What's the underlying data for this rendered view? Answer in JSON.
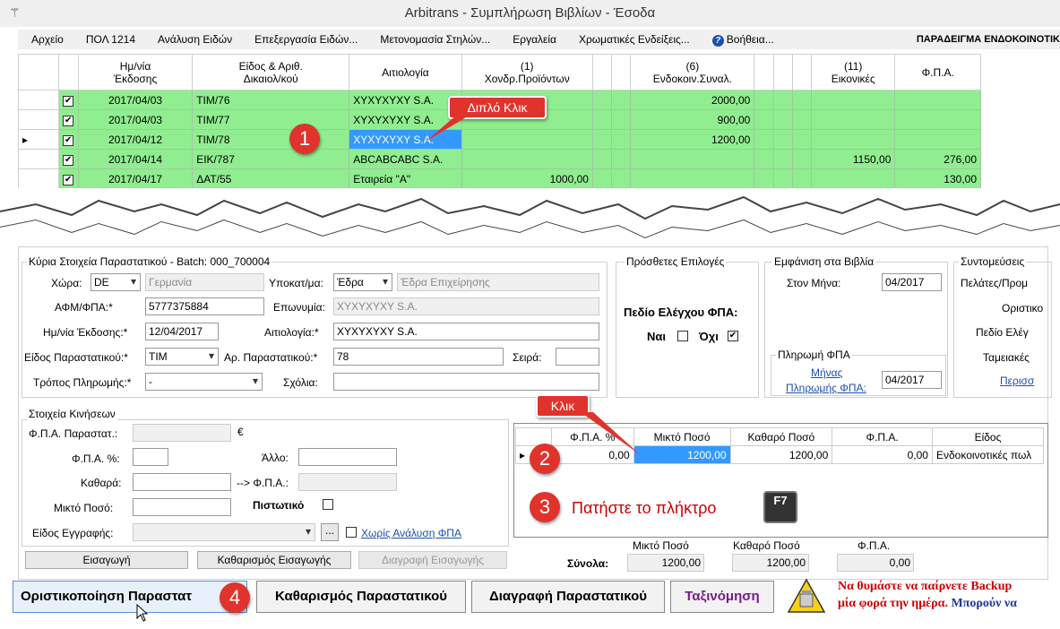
{
  "window": {
    "title": "Arbitrans - Συμπλήρωση Βιβλίων - Έσοδα"
  },
  "menu": {
    "items": [
      "Αρχείο",
      "ΠΟΛ 1214",
      "Ανάλυση Ειδών",
      "Επεξεργασία Ειδών...",
      "Μετονομασία Στηλών...",
      "Εργαλεία",
      "Χρωματικές Ενδείξεις..."
    ],
    "help": "Βοήθεια...",
    "right_label": "ΠΑΡΑΔΕΙΓΜΑ ΕΝΔΟΚΟΙΝΟΤΙΚ"
  },
  "grid": {
    "headers": {
      "date": [
        "Ημ/νία",
        "Έκδοσης"
      ],
      "doc": [
        "Είδος & Αριθ.",
        "Δικαιολ/κού"
      ],
      "reason": "Αιτιολογία",
      "col1": [
        "(1)",
        "Χονδρ.Προϊόντων"
      ],
      "col6": [
        "(6)",
        "Ενδοκοιν.Συναλ."
      ],
      "col11": [
        "(11)",
        "Εικονικές"
      ],
      "vat": "Φ.Π.Α."
    },
    "rows": [
      {
        "checked": "✔",
        "date": "2017/04/03",
        "doc": "ΤΙΜ/76",
        "reason": "XYXYXYXY S.A.",
        "c1": "",
        "c6": "2000,00",
        "c11": "",
        "vat": ""
      },
      {
        "checked": "✔",
        "date": "2017/04/03",
        "doc": "ΤΙΜ/77",
        "reason": "XYXYXYXY S.A.",
        "c1": "",
        "c6": "900,00",
        "c11": "",
        "vat": ""
      },
      {
        "checked": "✔",
        "date": "2017/04/12",
        "doc": "ΤΙΜ/78",
        "reason": "XYXYXYXY S.A.",
        "c1": "",
        "c6": "1200,00",
        "c11": "",
        "vat": ""
      },
      {
        "checked": "✔",
        "date": "2017/04/14",
        "doc": "ΕΙΚ/787",
        "reason": "ABCABCABC S.A.",
        "c1": "",
        "c6": "",
        "c11": "1150,00",
        "vat": "276,00"
      },
      {
        "checked": "✔",
        "date": "2017/04/17",
        "doc": "ΔΑΤ/55",
        "reason": "Εταιρεία \"Α\"",
        "c1": "1000,00",
        "c6": "",
        "c11": "",
        "vat": "130,00"
      }
    ],
    "row_pointer": "▸"
  },
  "annotations": {
    "b1": "1",
    "b2": "2",
    "b3": "3",
    "b4": "4",
    "double_click": "Διπλό Κλικ",
    "click": "Κλικ",
    "press_key": "Πατήστε το πλήκτρο",
    "key": "F7"
  },
  "main": {
    "title": "Κύρια Στοιχεία Παραστατικού - Batch: 000_700004",
    "country_lbl": "Χώρα:",
    "country_code": "DE",
    "country_name": "Γερμανία",
    "branch_lbl": "Υποκατ/μα:",
    "branch": "Έδρα",
    "branch_desc": "Έδρα Επιχείρησης",
    "vat_lbl": "ΑΦΜ/ΦΠΑ:*",
    "vat": "5777375884",
    "name_lbl": "Επωνυμία:",
    "name": "XYXYXYXY S.A.",
    "date_lbl": "Ημ/νία Έκδοσης:*",
    "date": "12/04/2017",
    "reason_lbl": "Αιτιολογία:*",
    "reason": "XYXYXYXY S.A.",
    "doctype_lbl": "Είδος Παραστατικού:*",
    "doctype": "ΤΙΜ",
    "docno_lbl": "Αρ. Παραστατικού:*",
    "docno": "78",
    "series_lbl": "Σειρά:",
    "series": "",
    "payment_lbl": "Τρόπος Πληρωμής:*",
    "payment": "-",
    "comments_lbl": "Σχόλια:",
    "comments": ""
  },
  "extra": {
    "title": "Πρόσθετες Επιλογές",
    "vat_check": "Πεδίο Ελέγχου ΦΠΑ:",
    "yes": "Ναι",
    "no": "Όχι",
    "no_mark": "✔"
  },
  "books": {
    "title": "Εμφάνιση στα Βιβλία",
    "month_lbl": "Στον Μήνα:",
    "month": "04/2017",
    "vatpay_title": "Πληρωμή ΦΠΑ",
    "vatpay_link1": "Μήνας",
    "vatpay_link2": "Πληρωμής ΦΠΑ:",
    "vatpay_month": "04/2017"
  },
  "shortcuts": {
    "title": "Συντομεύσεις",
    "items": [
      "Πελάτες/Προμ",
      "Οριστικο",
      "Πεδίο Ελέγ",
      "Ταμειακές"
    ],
    "more": "Περισσ"
  },
  "moves": {
    "title": "Στοιχεία Κινήσεων",
    "vat_doc_lbl": "Φ.Π.Α. Παραστατ.:",
    "euro": "€",
    "vat_pct_lbl": "Φ.Π.Α. %:",
    "other_lbl": "Άλλο:",
    "net_lbl": "Καθαρά:",
    "to_vat_lbl": "--> Φ.Π.Α.:",
    "gross_lbl": "Μικτό Ποσό:",
    "credit_lbl": "Πιστωτικό",
    "entry_type_lbl": "Είδος Εγγραφής:",
    "ellipsis": "...",
    "no_vat_lbl": "Χωρίς Ανάλυση ΦΠΑ",
    "btn_insert": "Εισαγωγή",
    "btn_clear_insert": "Καθαρισμός Εισαγωγής",
    "btn_delete_insert": "Διαγραφή Εισαγωγής"
  },
  "lines": {
    "headers": [
      "Φ.Π.Α. %",
      "Μικτό Ποσό",
      "Καθαρό Ποσό",
      "Φ.Π.Α.",
      "Είδος"
    ],
    "row": [
      "0,00",
      "1200,00",
      "1200,00",
      "0,00",
      "Ενδοκοινοτικές πωλ"
    ]
  },
  "totals": {
    "label": "Σύνολα:",
    "gross_lbl": "Μικτό Ποσό",
    "gross": "1200,00",
    "net_lbl": "Καθαρό Ποσό",
    "net": "1200,00",
    "vat_lbl": "Φ.Π.Α.",
    "vat": "0,00"
  },
  "actions": {
    "finalize": "Οριστικοποίηση Παραστατ",
    "clear": "Καθαρισμός Παραστατικού",
    "delete": "Διαγραφή Παραστατικού",
    "sort": "Ταξινόμηση"
  },
  "backup": {
    "line1": "Να θυμάστε να παίρνετε Backup",
    "line2a": "μία φορά την ημέρα.",
    "line2b": "Μπορούν να"
  },
  "colors": {
    "row_green": "#90ee90",
    "badge_red": "#e0332c",
    "selection_blue": "#3399ff"
  }
}
